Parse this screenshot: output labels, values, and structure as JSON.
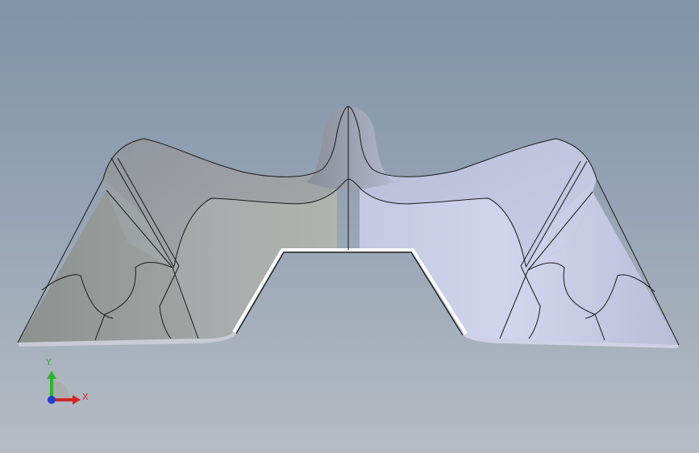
{
  "viewport": {
    "background_top": "#7f93a9",
    "background_bottom": "#b6bcc4"
  },
  "model": {
    "shaded_left": "#9da2a2",
    "shaded_right": "#c8cce4",
    "edge_color": "#1a1a1a",
    "section_color": "#ffffff"
  },
  "triad": {
    "axes": {
      "y": {
        "label": "Y",
        "color": "#2db52d"
      },
      "x": {
        "label": "X",
        "color": "#d32626"
      },
      "z": {
        "label": "",
        "color": "#1f3fd6"
      }
    }
  }
}
